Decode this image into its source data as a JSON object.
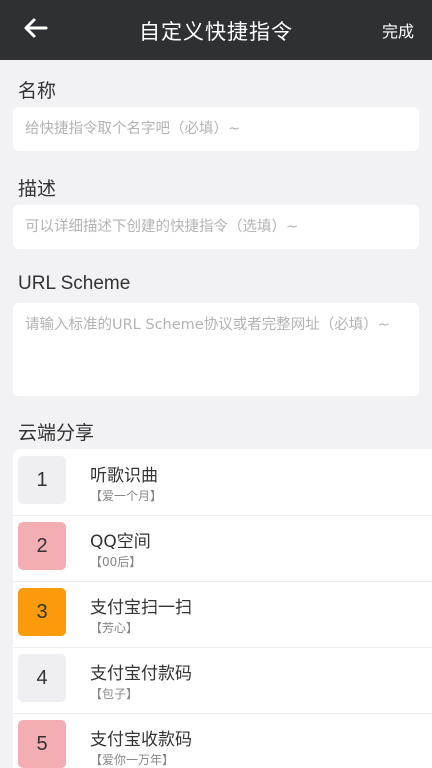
{
  "header": {
    "back_icon": "arrow-left-icon",
    "title": "自定义快捷指令",
    "done_label": "完成"
  },
  "form": {
    "name": {
      "label": "名称",
      "placeholder": "给快捷指令取个名字吧（必填）~"
    },
    "description": {
      "label": "描述",
      "placeholder": "可以详细描述下创建的快捷指令（选填）~"
    },
    "url_scheme": {
      "label": "URL Scheme",
      "placeholder": "请输入标准的URL Scheme协议或者完整网址（必填）~"
    }
  },
  "cloud_share": {
    "label": "云端分享",
    "items": [
      {
        "rank": "1",
        "name": "听歌识曲",
        "author": "【爱一个月】",
        "badge_color": "#efeff3"
      },
      {
        "rank": "2",
        "name": "QQ空间",
        "author": "【00后】",
        "badge_color": "#f4aeb3"
      },
      {
        "rank": "3",
        "name": "支付宝扫一扫",
        "author": "【芳心】",
        "badge_color": "#fb9a0a"
      },
      {
        "rank": "4",
        "name": "支付宝付款码",
        "author": "【包子】",
        "badge_color": "#efeff3"
      },
      {
        "rank": "5",
        "name": "支付宝收款码",
        "author": "【爱你一万年】",
        "badge_color": "#f4aeb3"
      }
    ]
  }
}
